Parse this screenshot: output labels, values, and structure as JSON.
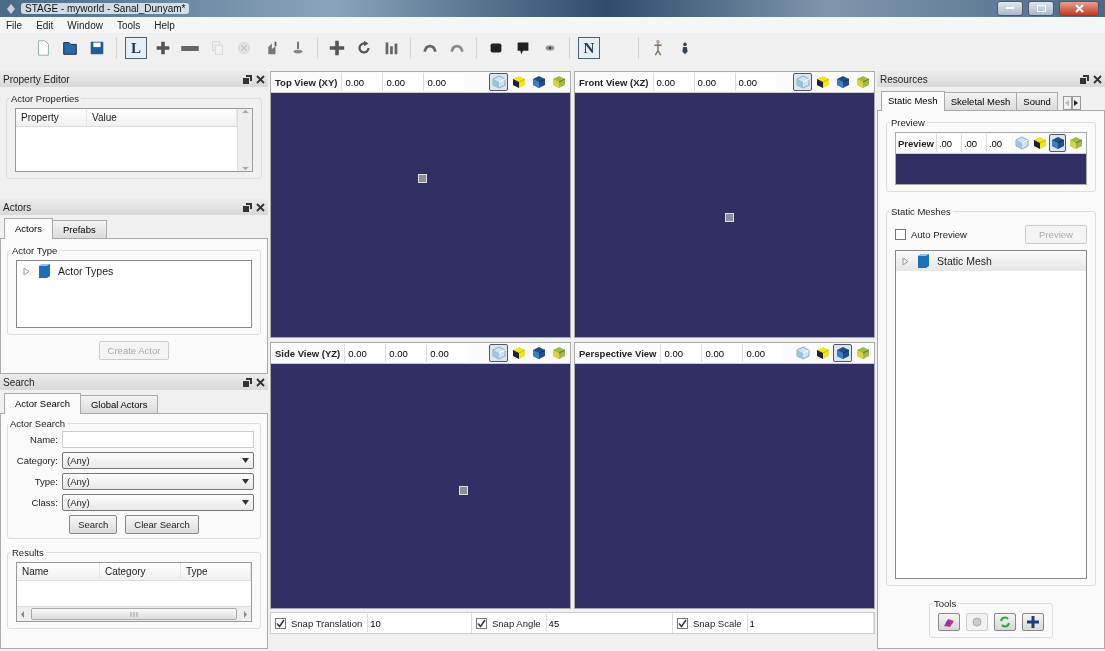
{
  "window": {
    "title": "STAGE - myworld - Sanal_Dunyam*"
  },
  "menu": [
    "File",
    "Edit",
    "Window",
    "Tools",
    "Help"
  ],
  "toolbar": [
    [
      {
        "kind": "icon",
        "disabled": false
      },
      {
        "kind": "icon",
        "disabled": false
      },
      {
        "kind": "icon",
        "disabled": false
      }
    ],
    [
      {
        "kind": "text",
        "label": "L",
        "selected": true
      },
      {
        "kind": "icon",
        "disabled": false
      },
      {
        "kind": "icon",
        "disabled": false
      },
      {
        "kind": "icon",
        "disabled": true
      },
      {
        "kind": "icon",
        "disabled": true
      },
      {
        "kind": "icon",
        "disabled": false
      },
      {
        "kind": "icon",
        "disabled": false
      }
    ],
    [
      {
        "kind": "icon",
        "disabled": false
      },
      {
        "kind": "icon",
        "disabled": false
      },
      {
        "kind": "icon",
        "disabled": false
      }
    ],
    [
      {
        "kind": "icon",
        "disabled": false
      },
      {
        "kind": "icon",
        "disabled": false
      }
    ],
    [
      {
        "kind": "icon",
        "disabled": false
      },
      {
        "kind": "icon",
        "disabled": false
      },
      {
        "kind": "icon",
        "disabled": false
      }
    ],
    [
      {
        "kind": "text",
        "label": "N",
        "selected": true
      }
    ],
    [
      {
        "kind": "icon",
        "disabled": false
      },
      {
        "kind": "icon",
        "disabled": false
      }
    ]
  ],
  "property_editor": {
    "title": "Property Editor",
    "group": "Actor Properties",
    "columns": [
      "Property",
      "Value"
    ]
  },
  "actors": {
    "title": "Actors",
    "tabs": [
      {
        "label": "Actors",
        "selected": true
      },
      {
        "label": "Prefabs",
        "selected": false
      }
    ],
    "group": "Actor Type",
    "tree": [
      {
        "label": "Actor Types",
        "expanded": false
      }
    ],
    "button": {
      "label": "Create Actor",
      "disabled": true
    }
  },
  "search": {
    "title": "Search",
    "tabs": [
      {
        "label": "Actor Search",
        "selected": true
      },
      {
        "label": "Global Actors",
        "selected": false
      }
    ],
    "group": "Actor Search",
    "name_label": "Name:",
    "combos": [
      {
        "label": "Category:",
        "value": "(Any)"
      },
      {
        "label": "Type:",
        "value": "(Any)"
      },
      {
        "label": "Class:",
        "value": "(Any)"
      }
    ],
    "buttons": [
      {
        "label": "Search",
        "disabled": false
      },
      {
        "label": "Clear Search",
        "disabled": false
      }
    ],
    "results": {
      "group": "Results",
      "columns": [
        "Name",
        "Category",
        "Type"
      ]
    }
  },
  "viewports": [
    {
      "title": "Top View (XY)",
      "fields": [
        "0.00",
        "0.00",
        "0.00"
      ],
      "modes": [
        {
          "selected": true
        },
        {
          "selected": false
        },
        {
          "selected": false
        },
        {
          "selected": false
        }
      ],
      "marker": true
    },
    {
      "title": "Front View (XZ)",
      "fields": [
        "0.00",
        "0.00",
        "0.00"
      ],
      "modes": [
        {
          "selected": true
        },
        {
          "selected": false
        },
        {
          "selected": false
        },
        {
          "selected": false
        }
      ],
      "marker": true
    },
    {
      "title": "Side View (YZ)",
      "fields": [
        "0.00",
        "0.00",
        "0.00"
      ],
      "modes": [
        {
          "selected": true
        },
        {
          "selected": false
        },
        {
          "selected": false
        },
        {
          "selected": false
        }
      ],
      "marker": true
    },
    {
      "title": "Perspective View",
      "fields": [
        "0.00",
        "0.00",
        "0.00"
      ],
      "modes": [
        {
          "selected": false
        },
        {
          "selected": false
        },
        {
          "selected": true
        },
        {
          "selected": false
        }
      ]
    }
  ],
  "snap": [
    {
      "label": "Snap Translation",
      "checked": true,
      "value": "10"
    },
    {
      "label": "Snap Angle",
      "checked": true,
      "value": "45"
    },
    {
      "label": "Snap Scale",
      "checked": true,
      "value": "1"
    }
  ],
  "resources": {
    "title": "Resources",
    "tabs": [
      {
        "label": "Static Mesh",
        "selected": true
      },
      {
        "label": "Skeletal Mesh",
        "selected": false
      },
      {
        "label": "Sound",
        "selected": false
      }
    ],
    "preview": {
      "group": "Preview",
      "title": "Preview",
      "fields": [
        ".00",
        ".00",
        ".00"
      ],
      "modes": [
        {
          "selected": false
        },
        {
          "selected": false
        },
        {
          "selected": true
        },
        {
          "selected": false
        }
      ]
    },
    "static_meshes": {
      "group": "Static Meshes",
      "auto_preview": {
        "label": "Auto Preview",
        "checked": false
      },
      "button": {
        "label": "Preview",
        "disabled": true
      },
      "tree": [
        {
          "label": "Static Mesh",
          "expanded": false
        }
      ]
    },
    "tools": {
      "group": "Tools",
      "buttons": [
        {
          "disabled": false
        },
        {
          "disabled": true
        },
        {
          "disabled": false
        },
        {
          "disabled": false
        }
      ]
    }
  }
}
